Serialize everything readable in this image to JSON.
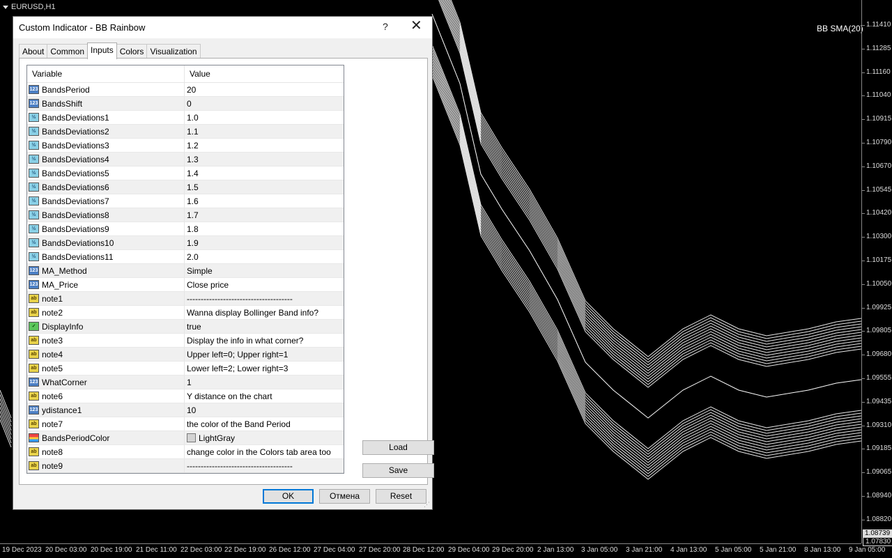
{
  "chart": {
    "symbol": "EURUSD,H1",
    "indicator_label": "BB SMA(20)",
    "price_ticks": [
      "1.11410",
      "1.11285",
      "1.11160",
      "1.11040",
      "1.10915",
      "1.10790",
      "1.10670",
      "1.10545",
      "1.10420",
      "1.10300",
      "1.10175",
      "1.10050",
      "1.09925",
      "1.09805",
      "1.09680",
      "1.09555",
      "1.09435",
      "1.09310",
      "1.09185",
      "1.09065",
      "1.08940",
      "1.08820"
    ],
    "current_price": "1.08739",
    "current_price2": "1.07830",
    "time_ticks": [
      "19 Dec 2023",
      "20 Dec 03:00",
      "20 Dec 19:00",
      "21 Dec 11:00",
      "22 Dec 03:00",
      "22 Dec 19:00",
      "26 Dec 12:00",
      "27 Dec 04:00",
      "27 Dec 20:00",
      "28 Dec 12:00",
      "29 Dec 04:00",
      "29 Dec 20:00",
      "2 Jan 13:00",
      "3 Jan 05:00",
      "3 Jan 21:00",
      "4 Jan 13:00",
      "5 Jan 05:00",
      "5 Jan 21:00",
      "8 Jan 13:00",
      "9 Jan 05:00"
    ]
  },
  "dialog": {
    "title": "Custom Indicator - BB Rainbow",
    "help": "?",
    "close": "✕",
    "tabs": [
      "About",
      "Common",
      "Inputs",
      "Colors",
      "Visualization"
    ],
    "active_tab": "Inputs",
    "grid": {
      "col_variable": "Variable",
      "col_value": "Value",
      "rows": [
        {
          "icon": "int",
          "name": "BandsPeriod",
          "value": "20"
        },
        {
          "icon": "int",
          "name": "BandsShift",
          "value": "0"
        },
        {
          "icon": "dbl",
          "name": "BandsDeviations1",
          "value": "1.0"
        },
        {
          "icon": "dbl",
          "name": "BandsDeviations2",
          "value": "1.1"
        },
        {
          "icon": "dbl",
          "name": "BandsDeviations3",
          "value": "1.2"
        },
        {
          "icon": "dbl",
          "name": "BandsDeviations4",
          "value": "1.3"
        },
        {
          "icon": "dbl",
          "name": "BandsDeviations5",
          "value": "1.4"
        },
        {
          "icon": "dbl",
          "name": "BandsDeviations6",
          "value": "1.5"
        },
        {
          "icon": "dbl",
          "name": "BandsDeviations7",
          "value": "1.6"
        },
        {
          "icon": "dbl",
          "name": "BandsDeviations8",
          "value": "1.7"
        },
        {
          "icon": "dbl",
          "name": "BandsDeviations9",
          "value": "1.8"
        },
        {
          "icon": "dbl",
          "name": "BandsDeviations10",
          "value": "1.9"
        },
        {
          "icon": "dbl",
          "name": "BandsDeviations11",
          "value": "2.0"
        },
        {
          "icon": "int",
          "name": "MA_Method",
          "value": "Simple"
        },
        {
          "icon": "int",
          "name": "MA_Price",
          "value": "Close price"
        },
        {
          "icon": "str",
          "name": "note1",
          "value": "--------------------------------------"
        },
        {
          "icon": "str",
          "name": "note2",
          "value": "Wanna display Bollinger Band info?"
        },
        {
          "icon": "bool",
          "name": "DisplayInfo",
          "value": "true"
        },
        {
          "icon": "str",
          "name": "note3",
          "value": "Display the info in what corner?"
        },
        {
          "icon": "str",
          "name": "note4",
          "value": "Upper left=0; Upper right=1"
        },
        {
          "icon": "str",
          "name": "note5",
          "value": "Lower left=2; Lower right=3"
        },
        {
          "icon": "int",
          "name": "WhatCorner",
          "value": "1"
        },
        {
          "icon": "str",
          "name": "note6",
          "value": "Y distance on the chart"
        },
        {
          "icon": "int",
          "name": "ydistance1",
          "value": "10"
        },
        {
          "icon": "str",
          "name": "note7",
          "value": "the color of the Band Period"
        },
        {
          "icon": "color",
          "name": "BandsPeriodColor",
          "value": "LightGray"
        },
        {
          "icon": "str",
          "name": "note8",
          "value": "change color in the Colors tab area too"
        },
        {
          "icon": "str",
          "name": "note9",
          "value": "--------------------------------------"
        }
      ]
    },
    "buttons": {
      "load": "Load",
      "save": "Save",
      "ok": "OK",
      "cancel": "Отмена",
      "reset": "Reset"
    }
  }
}
